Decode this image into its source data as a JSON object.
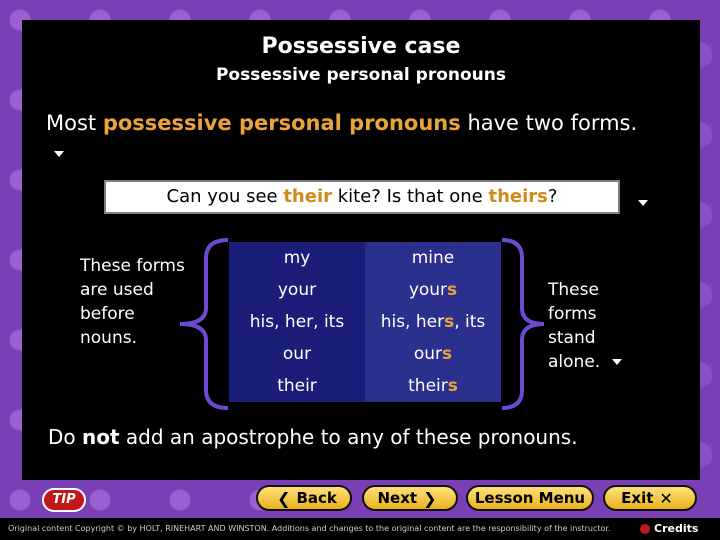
{
  "slide": {
    "title": "Possessive case",
    "subtitle": "Possessive personal pronouns",
    "intro": {
      "before": "Most ",
      "highlight": "possessive personal pronouns",
      "after": " have two forms."
    },
    "example": {
      "a": "Can you see ",
      "b": "their",
      "c": " kite? Is that one ",
      "d": "theirs",
      "e": "?"
    },
    "left_note": "These forms are used before nouns.",
    "right_note": "These forms stand alone.",
    "table": {
      "rows": [
        {
          "before": "my",
          "stem": "mine",
          "suffix": "",
          "tail": ""
        },
        {
          "before": "your",
          "stem": "your",
          "suffix": "s",
          "tail": ""
        },
        {
          "before": "his, her, its",
          "stem": "his, her",
          "suffix": "s",
          "tail": ", its"
        },
        {
          "before": "our",
          "stem": "our",
          "suffix": "s",
          "tail": ""
        },
        {
          "before": "their",
          "stem": "their",
          "suffix": "s",
          "tail": ""
        }
      ]
    },
    "bottom": {
      "a": "Do ",
      "b": "not",
      "c": " add an apostrophe to any of these pronouns."
    }
  },
  "nav": {
    "tip": "TIP",
    "back": "Back",
    "next": "Next",
    "lesson_menu": "Lesson Menu",
    "exit": "Exit",
    "copyright": "Original content Copyright © by HOLT, RINEHART AND WINSTON. Additions and changes to the original content are the responsibility of the instructor.",
    "credits": "Credits"
  },
  "colors": {
    "highlight": "#e9a33a",
    "table_dark": "#1a1e78",
    "table_light": "#2b2f8e",
    "button": "#f5c84a"
  }
}
